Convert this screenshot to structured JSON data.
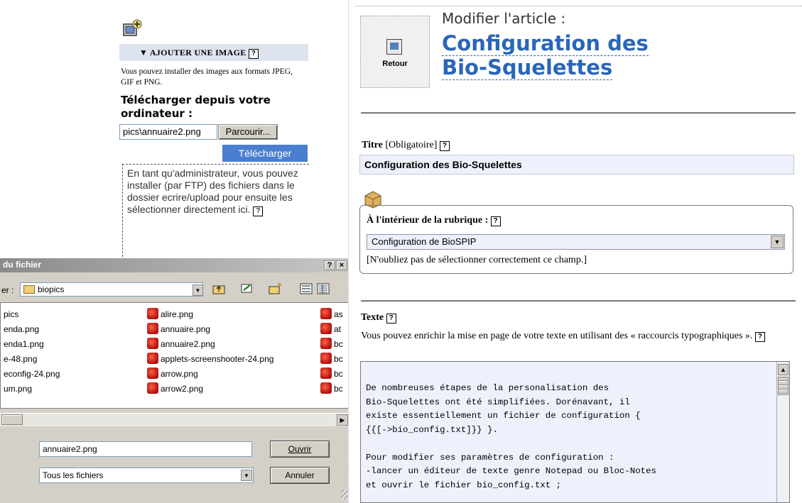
{
  "image_panel": {
    "title": "▼ AJOUTER UNE IMAGE",
    "formats_text": "Vous pouvez installer des images aux formats JPEG, GIF et PNG.",
    "upload_heading": "Télécharger depuis votre ordinateur :",
    "file_path_value": "pics\\annuaire2.png",
    "browse_label": "Parcourir...",
    "upload_label": "Télécharger",
    "ftp_note": "En tant qu'administrateur, vous pouvez installer (par FTP) des fichiers dans le dossier ecrire/upload pour ensuite les sélectionner directement ici."
  },
  "help_glyph": "?",
  "file_dialog": {
    "title": "du fichier",
    "help_btn": "?",
    "close_btn": "×",
    "look_in_label": "er :",
    "look_in_value": "biopics",
    "files_col1": [
      "pics",
      "enda.png",
      "enda1.png",
      "e-48.png",
      "econfig-24.png",
      "um.png"
    ],
    "files_col2": [
      "alire.png",
      "annuaire.png",
      "annuaire2.png",
      "applets-screenshooter-24.png",
      "arrow.png",
      "arrow2.png"
    ],
    "files_col3": [
      "as",
      "at",
      "bc",
      "bc",
      "bc",
      "bc"
    ],
    "filename_value": "annuaire2.png",
    "filetype_value": "Tous les fichiers",
    "open_label": "Ouvrir",
    "cancel_label": "Annuler"
  },
  "article": {
    "back_label": "Retour",
    "edit_kicker": "Modifier l'article :",
    "title": "Configuration des Bio-Squelettes",
    "titre_label": "Titre",
    "titre_required": "[Obligatoire]",
    "titre_value": "Configuration des Bio-Squelettes",
    "rubrique_label": "À l'intérieur de la rubrique :",
    "rubrique_value": "Configuration de BioSPIP",
    "rubrique_note": "[N'oubliez pas de sélectionner correctement ce champ.]",
    "texte_label": "Texte",
    "texte_help": "Vous pouvez enrichir la mise en page de votre texte en utilisant des « raccourcis typographiques ».",
    "texte_content": "De nombreuses étapes de la personalisation des\nBio-Squelettes ont été simplifiées. Dorénavant, il\nexiste essentiellement un fichier de configuration {\n{{[->bio_config.txt]}} }.\n\nPour modifier ses paramètres de configuration :\n-lancer un éditeur de texte genre Notepad ou Bloc-Notes\net ouvrir le fichier bio_config.txt ;"
  },
  "colors": {
    "accent_blue": "#2a66b8",
    "upload_button": "#4a7ed0",
    "field_bg": "#eef1fb",
    "dialog_bg": "#d4d0c8"
  }
}
